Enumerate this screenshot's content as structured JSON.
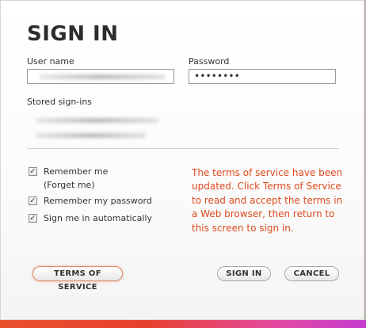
{
  "dialog": {
    "title": "SIGN IN",
    "username": {
      "label": "User name",
      "value": ""
    },
    "password": {
      "label": "Password",
      "value": "••••••••"
    },
    "stored_signins": {
      "label": "Stored sign-ins",
      "entries": [
        "",
        ""
      ]
    },
    "options": {
      "remember_me": {
        "label": "Remember me",
        "sublabel": "(Forget me)",
        "checked": true,
        "mark": "✓"
      },
      "remember_password": {
        "label": "Remember my password",
        "checked": true,
        "mark": "✓"
      },
      "auto_signin": {
        "label": "Sign me in automatically",
        "checked": true,
        "mark": "✓"
      }
    },
    "notice": "The terms of service have been updated. Click Terms of Service to read and accept the terms in a Web browser, then return to this screen to sign in.",
    "buttons": {
      "terms": "TERMS OF SERVICE",
      "signin": "SIGN IN",
      "cancel": "CANCEL"
    }
  },
  "colors": {
    "notice": "#e04a1e",
    "accent_bar_start": "#e8502c",
    "accent_bar_end": "#c53bd0"
  }
}
